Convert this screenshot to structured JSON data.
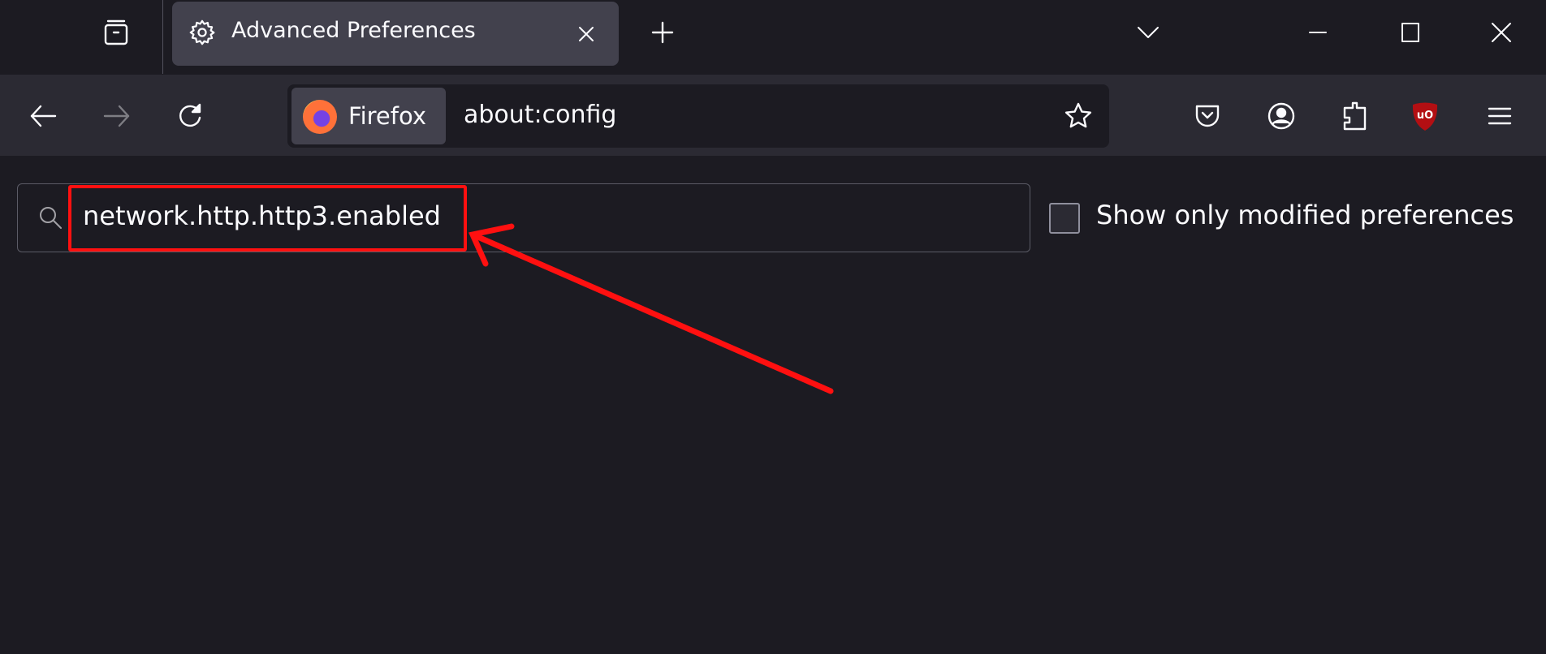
{
  "tab": {
    "title": "Advanced Preferences",
    "icon": "gear-icon"
  },
  "toolbar": {
    "identity_label": "Firefox",
    "url": "about:config"
  },
  "search": {
    "value": "network.http.http3.enabled",
    "icon": "search-icon"
  },
  "filter": {
    "label": "Show only modified preferences",
    "checked": false
  },
  "annotation": {
    "color": "#ff1010"
  },
  "colors": {
    "tab_strip": "#1c1b22",
    "toolbar": "#2b2a33",
    "active_tab": "#42414d",
    "ublock": "#b30f13"
  }
}
